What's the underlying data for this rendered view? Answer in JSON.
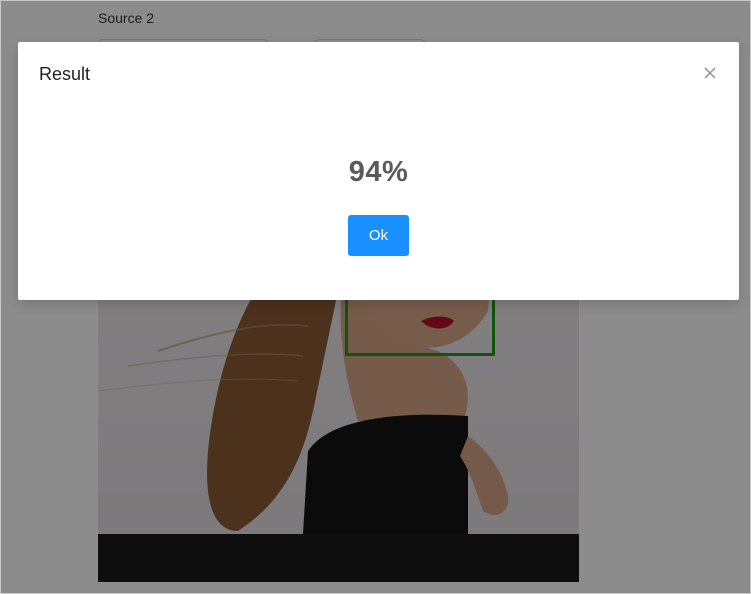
{
  "page": {
    "source_label": "Source 2"
  },
  "modal": {
    "title": "Result",
    "result": "94%",
    "ok_label": "Ok",
    "close_icon": "close-icon"
  },
  "colors": {
    "primary": "#1890ff",
    "face_box": "#1c9a1c",
    "mask": "rgba(0,0,0,0.45)"
  }
}
